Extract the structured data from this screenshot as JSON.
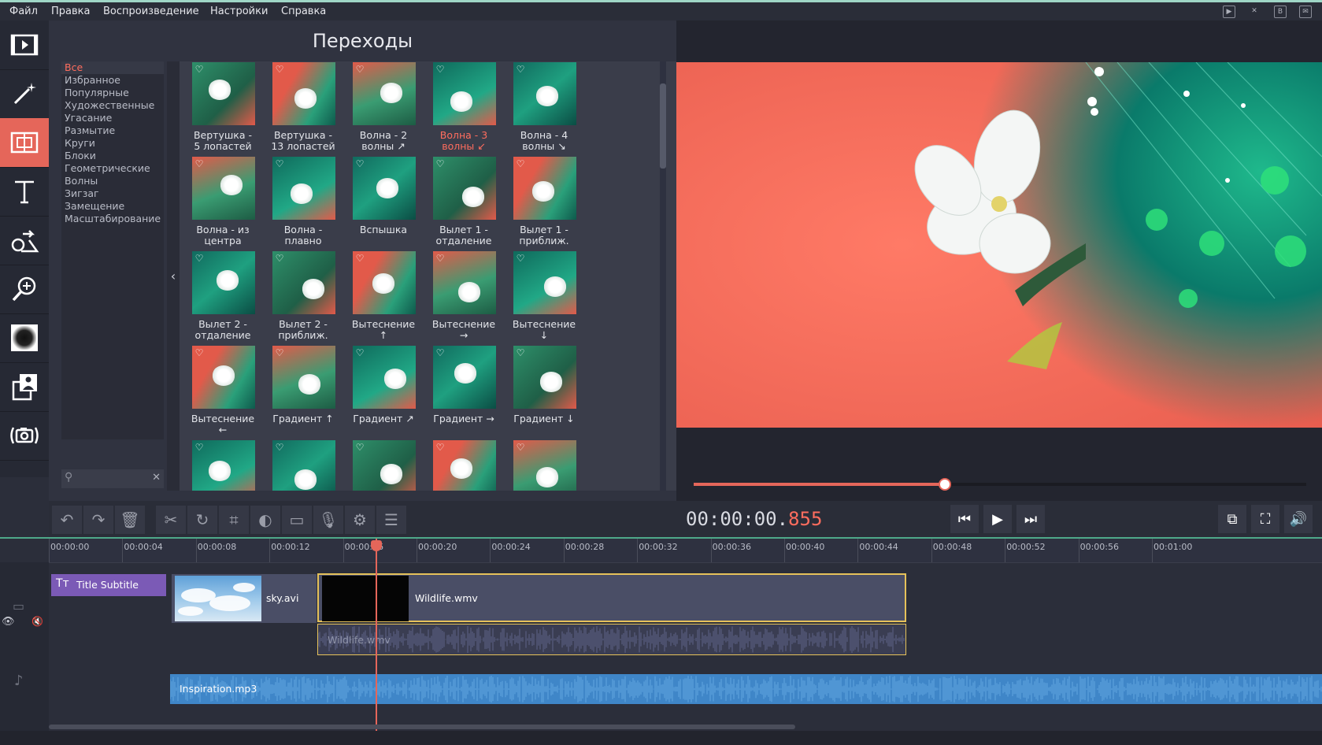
{
  "menu": [
    "Файл",
    "Правка",
    "Воспроизведение",
    "Настройки",
    "Справка"
  ],
  "window_icons": [
    "youtube-icon",
    "pin-icon",
    "b-icon",
    "feedback-icon"
  ],
  "tools": [
    {
      "name": "import-media-tool",
      "icon": "film-icon"
    },
    {
      "name": "filters-tool",
      "icon": "magic-wand-icon"
    },
    {
      "name": "transitions-tool",
      "icon": "transition-icon"
    },
    {
      "name": "titles-tool",
      "icon": "text-icon"
    },
    {
      "name": "stickers-tool",
      "icon": "shapes-icon"
    },
    {
      "name": "zoom-tool",
      "icon": "magnifier-icon"
    },
    {
      "name": "effects-tool",
      "icon": "vignette-icon"
    },
    {
      "name": "chroma-tool",
      "icon": "person-icon"
    },
    {
      "name": "capture-tool",
      "icon": "camera-icon"
    }
  ],
  "panel": {
    "title": "Переходы",
    "categories": [
      "Все",
      "Избранное",
      "Популярные",
      "Художественные",
      "Угасание",
      "Размытие",
      "Круги",
      "Блоки",
      "Геометрические",
      "Волны",
      "Зигзаг",
      "Замещение",
      "Масштабирование"
    ],
    "selected_category": "Все",
    "transitions": [
      [
        "Вертушка -",
        "5 лопастей"
      ],
      [
        "Вертушка -",
        "13 лопастей"
      ],
      [
        "Волна - 2",
        "волны ↗"
      ],
      [
        "Волна - 3",
        "волны ↙"
      ],
      [
        "Волна - 4",
        "волны ↘"
      ],
      [
        "Волна - из",
        "центра"
      ],
      [
        "Волна -",
        "плавно"
      ],
      [
        "Вспышка",
        ""
      ],
      [
        "Вылет 1 -",
        "отдаление"
      ],
      [
        "Вылет 1 -",
        "приближ."
      ],
      [
        "Вылет 2 -",
        "отдаление"
      ],
      [
        "Вылет 2 -",
        "приближ."
      ],
      [
        "Вытеснение",
        "↑"
      ],
      [
        "Вытеснение",
        "→"
      ],
      [
        "Вытеснение",
        "↓"
      ],
      [
        "Вытеснение",
        "←"
      ],
      [
        "Градиент ↑",
        ""
      ],
      [
        "Градиент ↗",
        ""
      ],
      [
        "Градиент →",
        ""
      ],
      [
        "Градиент ↓",
        ""
      ]
    ],
    "selected_transition_index": 3
  },
  "edit_tools": [
    "undo-icon",
    "redo-icon",
    "trash-icon",
    "scissors-icon",
    "rotate-icon",
    "crop-icon",
    "contrast-icon",
    "image-icon",
    "microphone-icon",
    "gear-icon",
    "equalizer-icon"
  ],
  "player": {
    "timecode_main": "00:00:00.",
    "timecode_ms": "855",
    "progress": 0.41
  },
  "timeline": {
    "ticks": [
      "00:00:00",
      "00:00:04",
      "00:00:08",
      "00:00:12",
      "00:00:16",
      "00:00:20",
      "00:00:24",
      "00:00:28",
      "00:00:32",
      "00:00:36",
      "00:00:40",
      "00:00:44",
      "00:00:48",
      "00:00:52",
      "00:00:56",
      "00:01:00"
    ],
    "title_clip": "Title Subtitle",
    "video_clips": [
      "sky.avi",
      "Wildlife.wmv"
    ],
    "clip_audio": "Wildlife.wmv",
    "music": "Inspiration.mp3"
  },
  "colors": {
    "accent": "#e5665a",
    "panel": "#303340",
    "music_track": "#3f86c8"
  }
}
